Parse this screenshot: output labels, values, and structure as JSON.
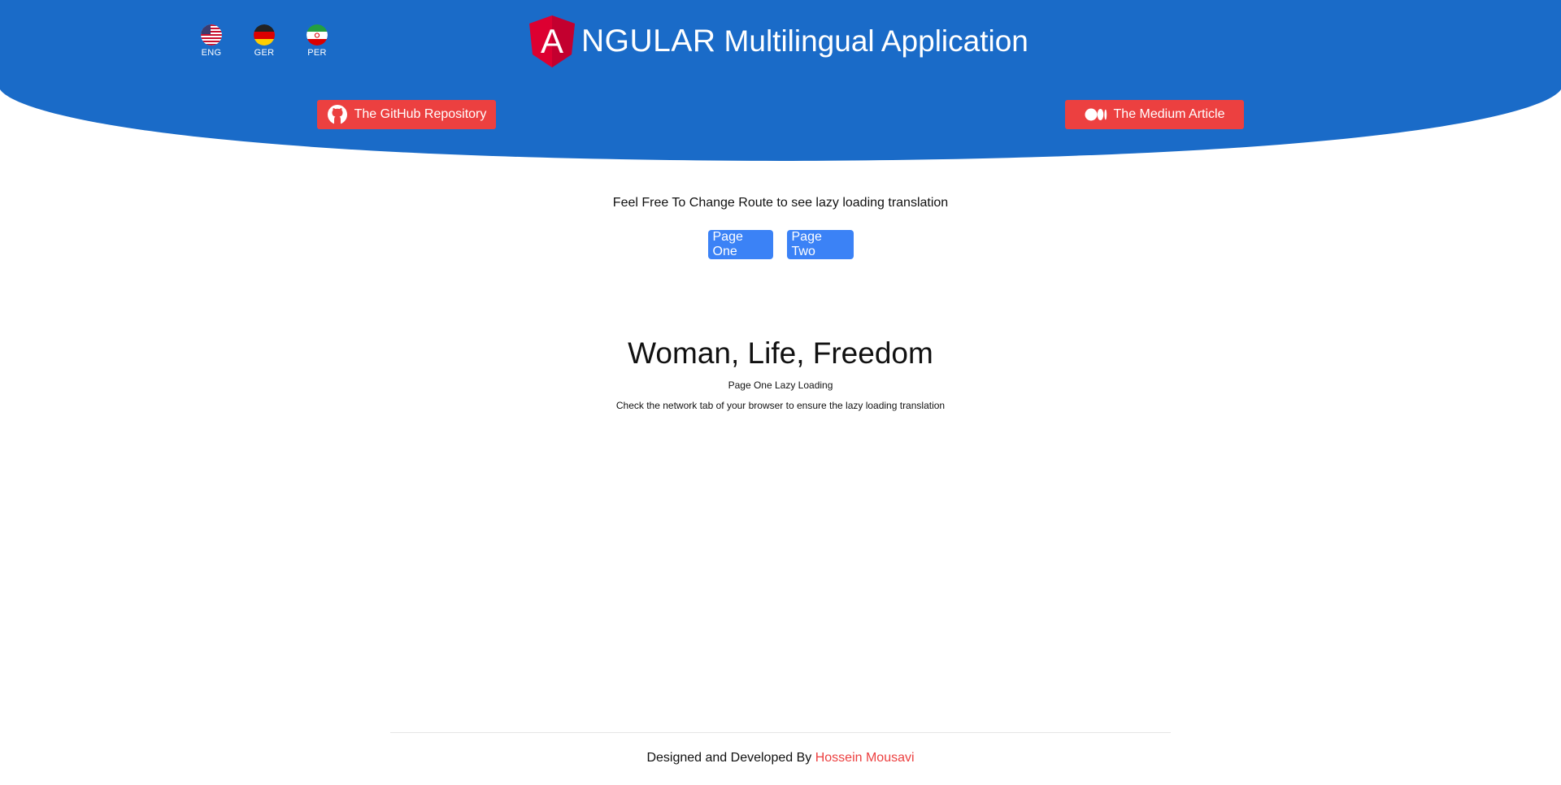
{
  "header": {
    "languages": [
      {
        "code": "ENG",
        "flag": "us-flag-icon"
      },
      {
        "code": "GER",
        "flag": "germany-flag-icon"
      },
      {
        "code": "PER",
        "flag": "iran-flag-icon"
      }
    ],
    "title_initial": "A",
    "title_brand": "NGULAR",
    "title_rest": "Multilingual Application",
    "github_button": "The GitHub Repository",
    "medium_button": "The Medium Article"
  },
  "main": {
    "hint": "Feel Free To Change Route to see lazy loading translation",
    "nav": {
      "page_one": "Page One",
      "page_two": "Page Two"
    },
    "slogan": "Woman, Life, Freedom",
    "subtitle": "Page One Lazy Loading",
    "note": "Check the network tab of your browser to ensure the lazy loading translation"
  },
  "footer": {
    "prefix": "Designed and Developed By",
    "author": "Hossein Mousavi"
  },
  "colors": {
    "header_blue": "#1a6bc8",
    "accent_red": "#ec4040",
    "nav_blue": "#3b82f6",
    "angular_red": "#dd0031"
  }
}
